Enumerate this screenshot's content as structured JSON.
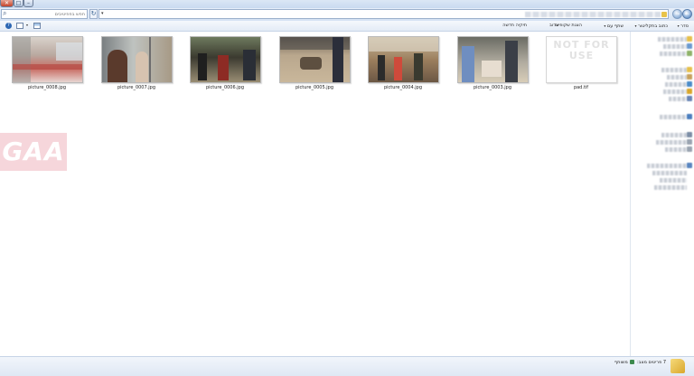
{
  "window": {
    "close_glyph": "✕",
    "max_glyph": "□",
    "min_glyph": "–"
  },
  "address": {
    "search_placeholder": "חפש בפוזיטיבים",
    "refresh_glyph": "↻",
    "dropdown_glyph": "▾"
  },
  "nav": {
    "back_glyph": "←",
    "forward_glyph": "→"
  },
  "toolbar": {
    "organize_label": "סדר",
    "burn_label": "כתוב בתקליטור",
    "share_label": "שתף עם",
    "slideshow_label": "הצגת שקופיות",
    "email_label": "צרוב",
    "new_folder_label": "תיקיה חדשה",
    "dropdown_arrow": "▾",
    "help_glyph": "?"
  },
  "files": [
    {
      "name": "picture_0008.jpg",
      "thumb_icon": "photo-thumbnail-icon"
    },
    {
      "name": "picture_0007.jpg",
      "thumb_icon": "photo-thumbnail-icon"
    },
    {
      "name": "picture_0006.jpg",
      "thumb_icon": "photo-thumbnail-icon"
    },
    {
      "name": "picture_0005.jpg",
      "thumb_icon": "photo-thumbnail-icon"
    },
    {
      "name": "picture_0004.jpg",
      "thumb_icon": "photo-thumbnail-icon"
    },
    {
      "name": "picture_0003.jpg",
      "thumb_icon": "photo-thumbnail-icon"
    },
    {
      "name": "pad.tif",
      "thumb_icon": "image-file-icon",
      "thumb_text": "NOT FOR USE"
    }
  ],
  "watermark": {
    "text": "GAA",
    "color": "#f3c9cf"
  },
  "details": {
    "item_count": "7 פריטים",
    "state_label": "מצב:",
    "state_value": "משותף"
  },
  "colors": {
    "titlebar": "#c9daf0",
    "close_button": "#c5442b",
    "selection_accent": "#2d67b3",
    "folder_yellow": "#d9a72c"
  }
}
